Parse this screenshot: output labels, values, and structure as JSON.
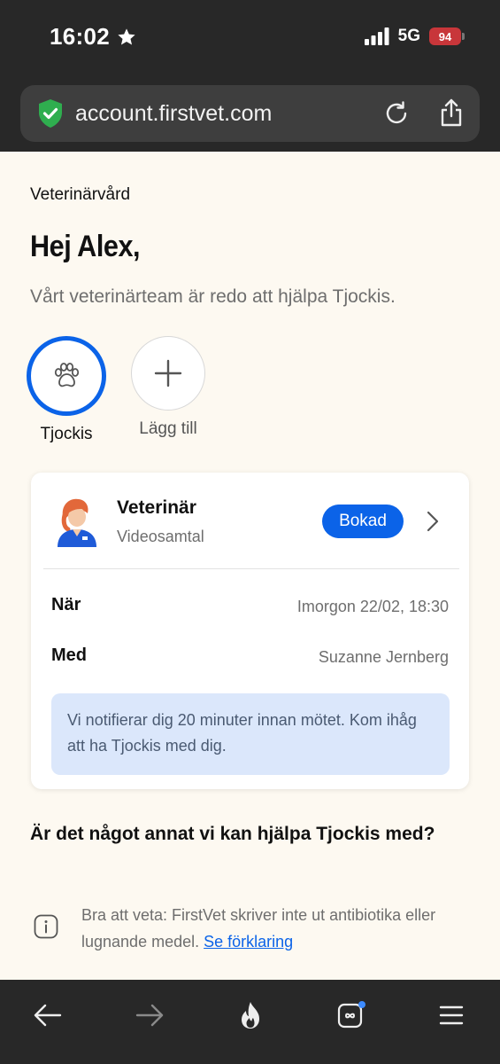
{
  "status_bar": {
    "time": "16:02",
    "network": "5G",
    "battery": "94"
  },
  "browser": {
    "url": "account.firstvet.com"
  },
  "page": {
    "breadcrumb": "Veterinärvård",
    "greeting": "Hej Alex,",
    "subtitle": "Vårt veterinärteam är redo att hjälpa Tjockis.",
    "pets": [
      {
        "label": "Tjockis",
        "icon": "paw-icon",
        "selected": true
      },
      {
        "label": "Lägg till",
        "icon": "plus-icon",
        "selected": false
      }
    ],
    "appointment": {
      "title": "Veterinär",
      "type": "Videosamtal",
      "status": "Bokad",
      "when_label": "När",
      "when_value": "Imorgon 22/02, 18:30",
      "with_label": "Med",
      "with_value": "Suzanne Jernberg",
      "notice": "Vi notifierar dig 20 minuter innan mötet. Kom ihåg att ha Tjockis med dig."
    },
    "question": "Är det något annat vi kan hjälpa Tjockis med?",
    "note": {
      "text": "Bra att veta: FirstVet skriver inte ut antibiotika eller lugnande medel.",
      "link": "Se förklaring"
    }
  },
  "colors": {
    "accent": "#0b63e8",
    "page_bg": "#fdf9f1",
    "chrome_bg": "#282828",
    "info_bg": "#dbe7fb"
  }
}
